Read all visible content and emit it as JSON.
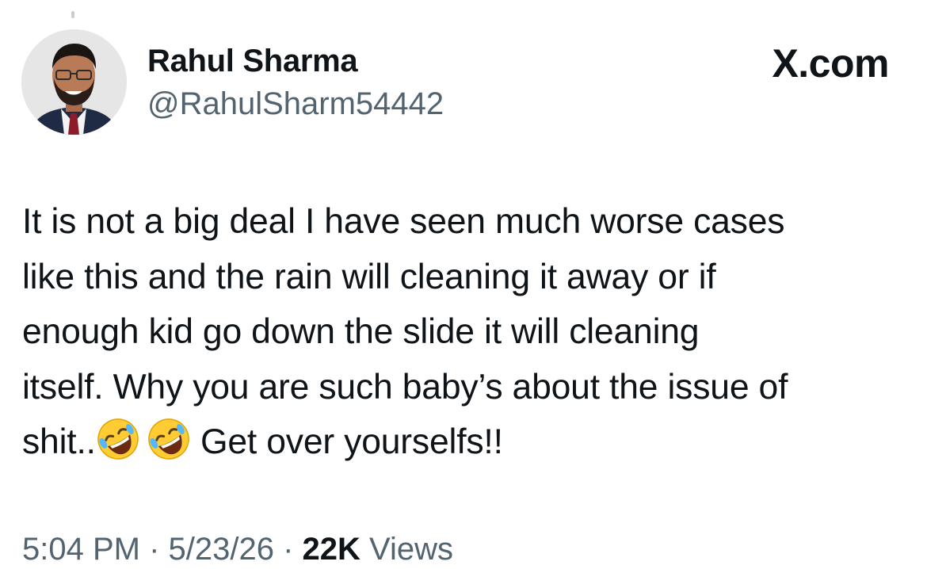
{
  "author": {
    "display_name": "Rahul Sharma",
    "handle": "@RahulSharm54442"
  },
  "brand": {
    "label": "X.com"
  },
  "tweet": {
    "lines": [
      "It is not a big deal I have seen much worse cases",
      "like this and the rain will cleaning it away or if",
      "enough kid go down the slide it will cleaning",
      "itself. Why you are such baby’s about the issue of"
    ],
    "last_line_start": "shit..",
    "last_line_end": " Get over yourselfs!!",
    "emojis": [
      "rolling-on-the-floor-laughing-emoji",
      "rolling-on-the-floor-laughing-emoji"
    ]
  },
  "meta": {
    "time": "5:04 PM",
    "separator": " · ",
    "date": "5/23/26",
    "views_count": "22K",
    "views_label": " Views"
  },
  "colors": {
    "text": "#0f1419",
    "secondary_text": "#536471",
    "background": "#ffffff"
  }
}
